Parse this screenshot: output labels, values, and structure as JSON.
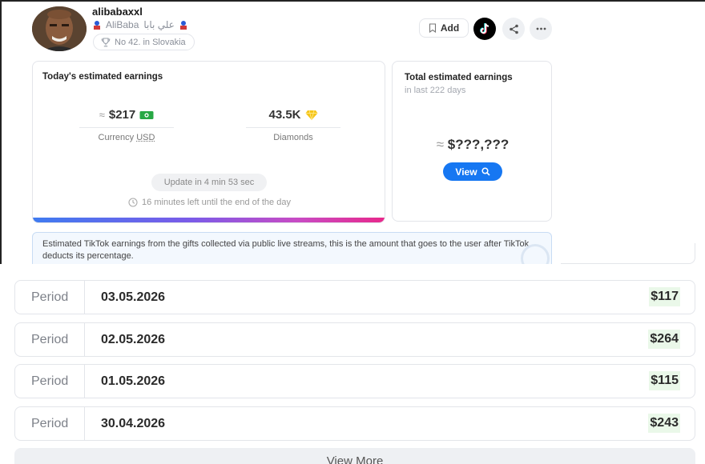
{
  "profile": {
    "username": "alibabaxxl",
    "nickname": "AliBaba",
    "nickname_arabic": "علي بابا",
    "rank": "No 42. in Slovakia"
  },
  "header_actions": {
    "add_label": "Add"
  },
  "today": {
    "title": "Today's estimated earnings",
    "usd_approx": "≈",
    "usd_value": "$217",
    "usd_label_prefix": "Currency ",
    "usd_label_unit": "USD",
    "diamonds_value": "43.5K",
    "diamonds_label": "Diamonds",
    "update_text": "Update in 4 min 53 sec",
    "time_left": "16 minutes left until the end of the day"
  },
  "total": {
    "title": "Total estimated earnings",
    "subtitle": "in last 222 days",
    "approx": "≈",
    "amount": "$???,???",
    "view_label": "View"
  },
  "info": {
    "text": "Estimated TikTok earnings from the gifts collected via public live streams, this is the amount that goes to the user after TikTok deducts its percentage."
  },
  "periods": [
    {
      "label": "Period",
      "date": "03.05.2026",
      "amount": "$117"
    },
    {
      "label": "Period",
      "date": "02.05.2026",
      "amount": "$264"
    },
    {
      "label": "Period",
      "date": "01.05.2026",
      "amount": "$115"
    },
    {
      "label": "Period",
      "date": "30.04.2026",
      "amount": "$243"
    }
  ],
  "view_more_label": "View More",
  "colors": {
    "accent_blue": "#1677f2",
    "amount_highlight": "#eaf8e9",
    "money_green": "#27a844",
    "diamond_yellow": "#f5c518"
  }
}
